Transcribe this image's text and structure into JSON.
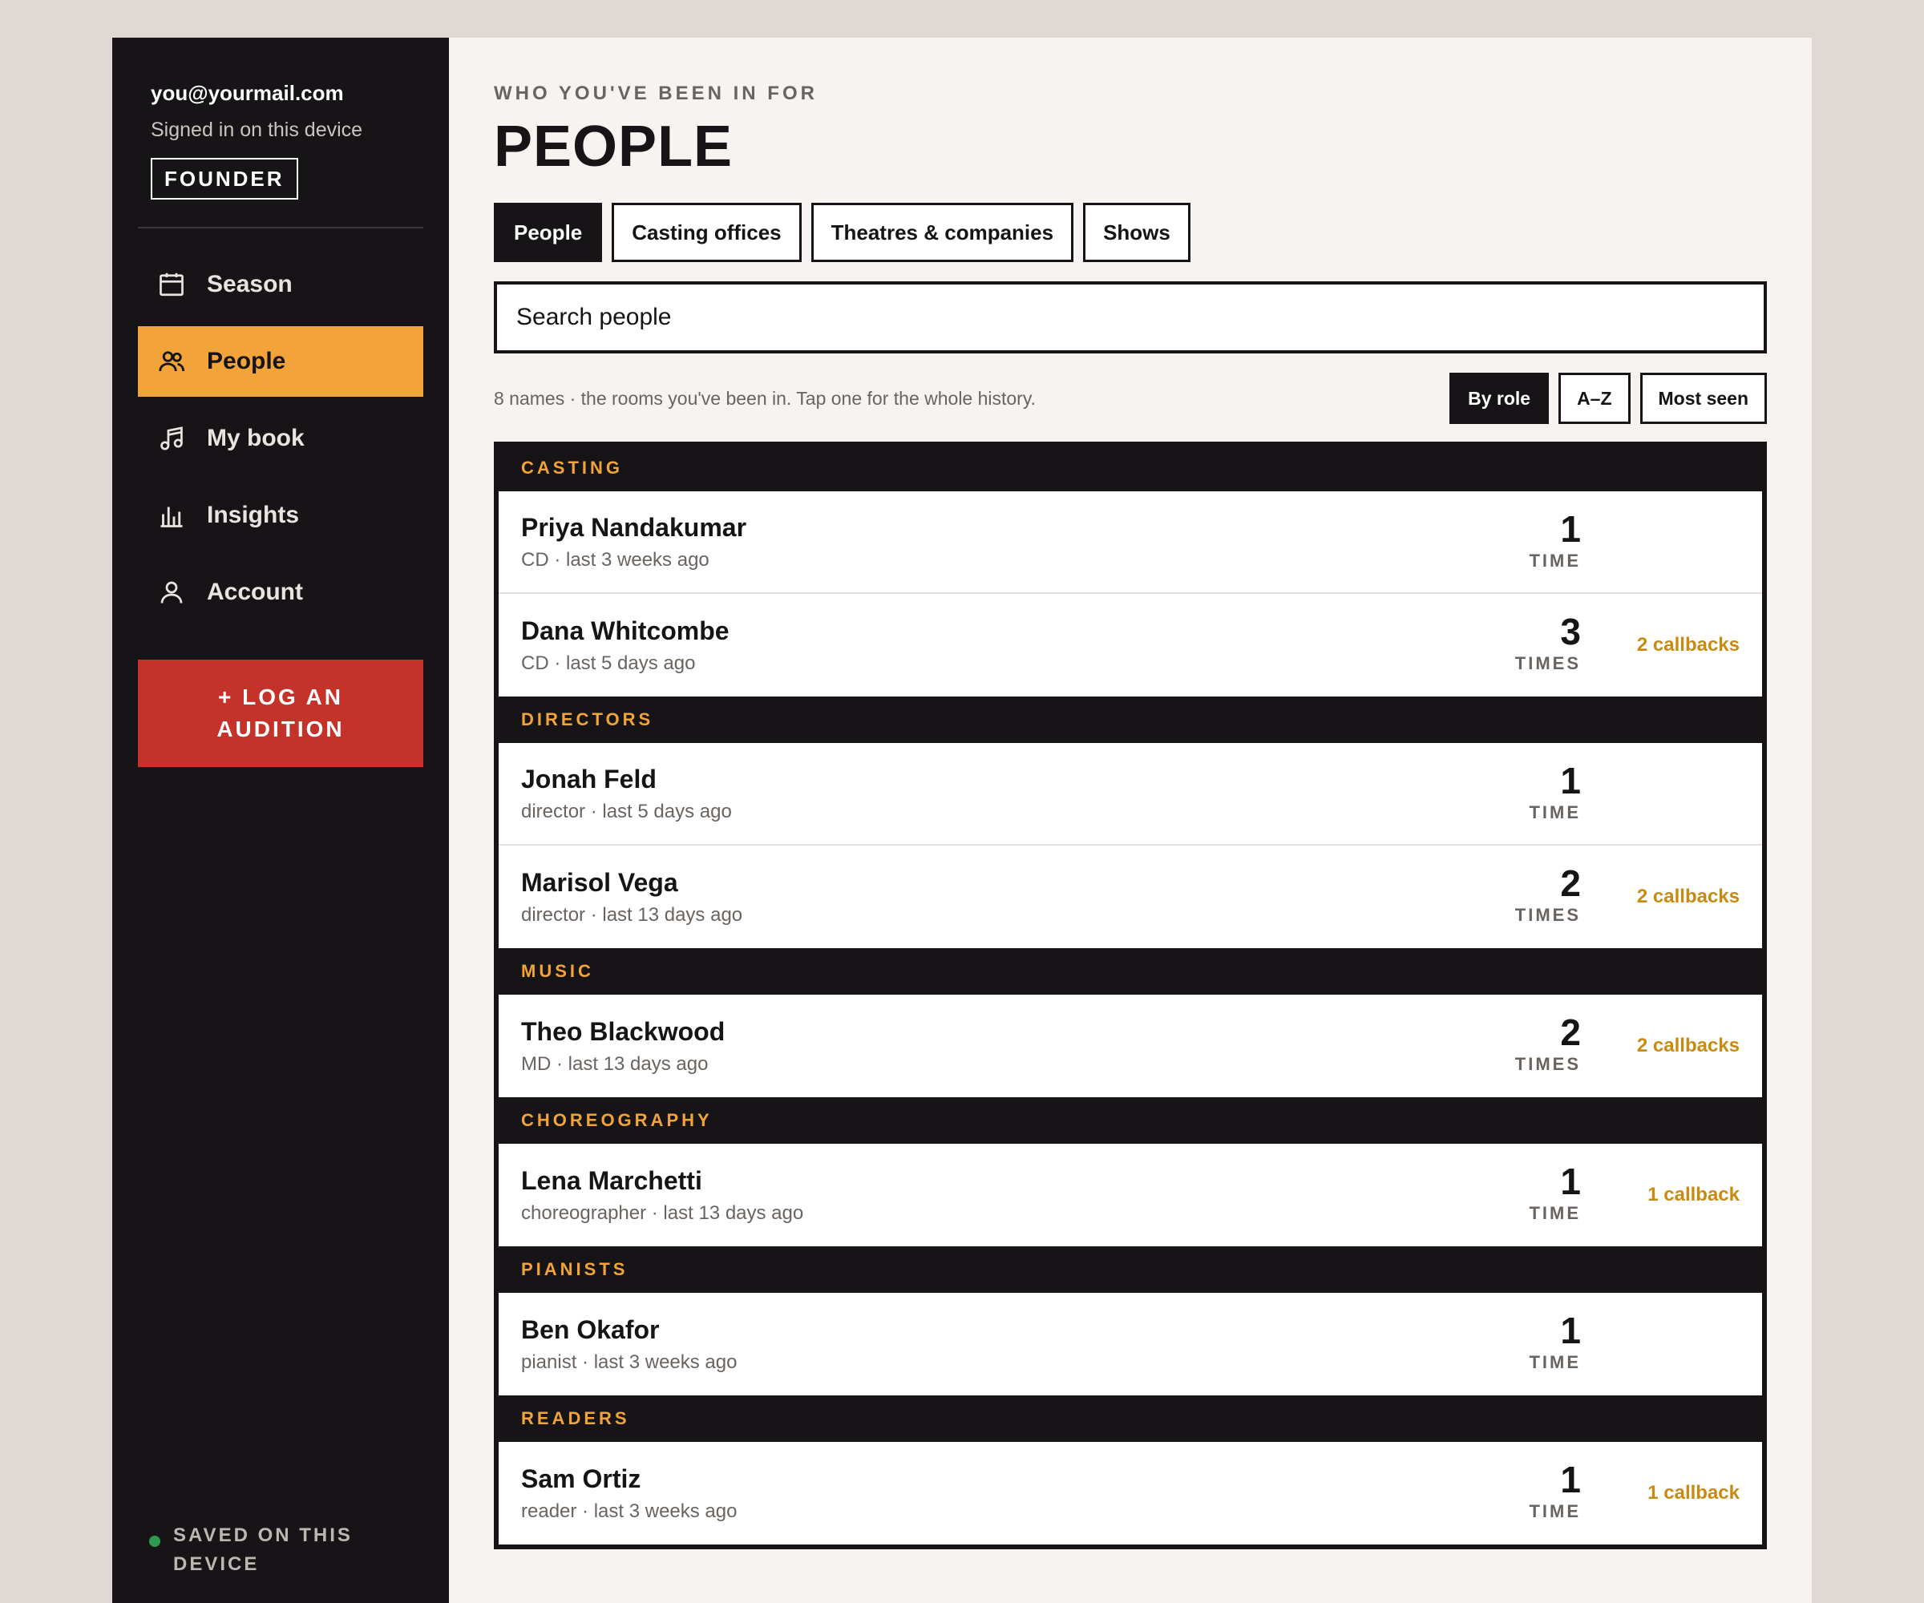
{
  "sidebar": {
    "email": "you@yourmail.com",
    "signed_in": "Signed in on this device",
    "badge": "FOUNDER",
    "nav": [
      {
        "label": "Season",
        "icon": "calendar-icon"
      },
      {
        "label": "People",
        "icon": "people-icon"
      },
      {
        "label": "My book",
        "icon": "music-note-icon"
      },
      {
        "label": "Insights",
        "icon": "bar-chart-icon"
      },
      {
        "label": "Account",
        "icon": "user-icon"
      }
    ],
    "log_button": "+ LOG AN\nAUDITION",
    "saved": "SAVED ON THIS DEVICE"
  },
  "main": {
    "eyebrow": "WHO YOU'VE BEEN IN FOR",
    "title": "PEOPLE",
    "tabs": [
      "People",
      "Casting offices",
      "Theatres & companies",
      "Shows"
    ],
    "search_placeholder": "Search people",
    "meta": "8 names · the rooms you've been in. Tap one for the whole history.",
    "sort": [
      "By role",
      "A–Z",
      "Most seen"
    ]
  },
  "groups": [
    {
      "title": "CASTING",
      "people": [
        {
          "name": "Priya Nandakumar",
          "sub": "CD · last 3 weeks ago",
          "count": "1",
          "unit": "TIME",
          "callbacks": ""
        },
        {
          "name": "Dana Whitcombe",
          "sub": "CD · last 5 days ago",
          "count": "3",
          "unit": "TIMES",
          "callbacks": "2 callbacks"
        }
      ]
    },
    {
      "title": "DIRECTORS",
      "people": [
        {
          "name": "Jonah Feld",
          "sub": "director · last 5 days ago",
          "count": "1",
          "unit": "TIME",
          "callbacks": ""
        },
        {
          "name": "Marisol Vega",
          "sub": "director · last 13 days ago",
          "count": "2",
          "unit": "TIMES",
          "callbacks": "2 callbacks"
        }
      ]
    },
    {
      "title": "MUSIC",
      "people": [
        {
          "name": "Theo Blackwood",
          "sub": "MD · last 13 days ago",
          "count": "2",
          "unit": "TIMES",
          "callbacks": "2 callbacks"
        }
      ]
    },
    {
      "title": "CHOREOGRAPHY",
      "people": [
        {
          "name": "Lena Marchetti",
          "sub": "choreographer · last 13 days ago",
          "count": "1",
          "unit": "TIME",
          "callbacks": "1 callback"
        }
      ]
    },
    {
      "title": "PIANISTS",
      "people": [
        {
          "name": "Ben Okafor",
          "sub": "pianist · last 3 weeks ago",
          "count": "1",
          "unit": "TIME",
          "callbacks": ""
        }
      ]
    },
    {
      "title": "READERS",
      "people": [
        {
          "name": "Sam Ortiz",
          "sub": "reader · last 3 weeks ago",
          "count": "1",
          "unit": "TIME",
          "callbacks": "1 callback"
        }
      ]
    }
  ]
}
